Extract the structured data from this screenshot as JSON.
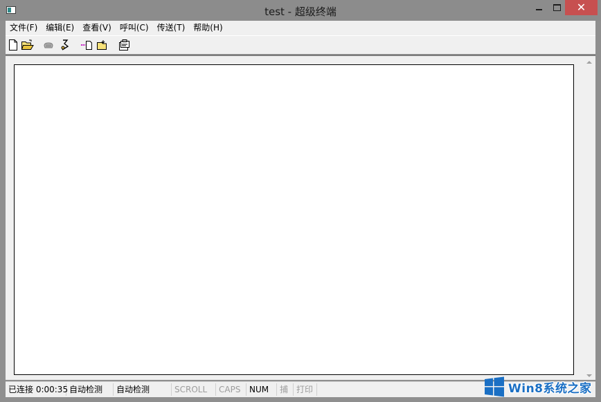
{
  "window": {
    "title": "test - 超级终端",
    "close_symbol": "✕"
  },
  "menu": [
    {
      "label": "文件(F)"
    },
    {
      "label": "编辑(E)"
    },
    {
      "label": "查看(V)"
    },
    {
      "label": "呼叫(C)"
    },
    {
      "label": "传送(T)"
    },
    {
      "label": "帮助(H)"
    }
  ],
  "toolbar": {
    "icons": [
      "new-file-icon",
      "open-folder-icon",
      "call-icon",
      "disconnect-icon",
      "send-icon",
      "receive-icon",
      "properties-icon"
    ]
  },
  "statusbar": {
    "connection": "已连接 0:00:35",
    "detect1": "自动检测",
    "detect2": "自动检测",
    "scroll": "SCROLL",
    "caps": "CAPS",
    "num": "NUM",
    "capture": "捕",
    "print": "打印"
  },
  "watermark": {
    "text": "Win8系统之家",
    "color": "#1a6fc4"
  }
}
